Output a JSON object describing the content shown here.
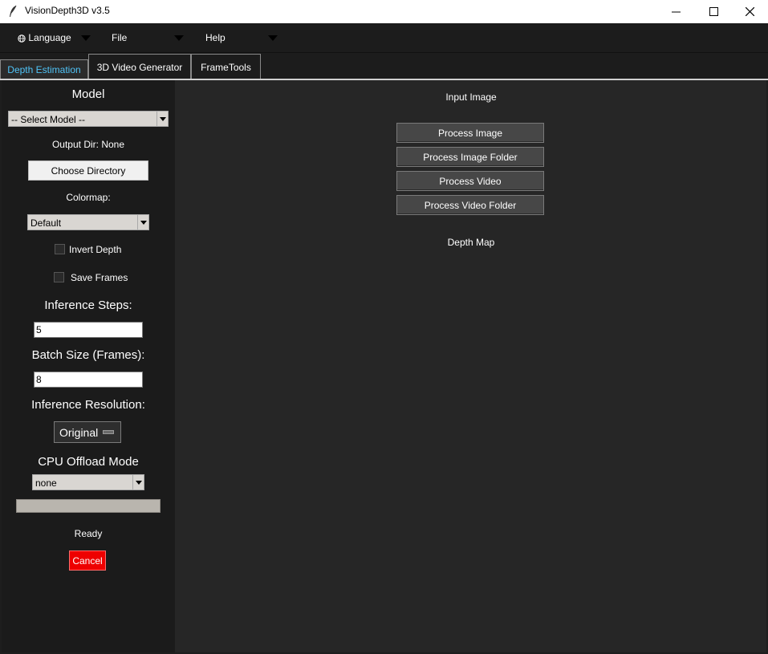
{
  "window": {
    "title": "VisionDepth3D v3.5"
  },
  "menubar": {
    "items": [
      {
        "label": "Language",
        "icon": "globe-icon"
      },
      {
        "label": "File"
      },
      {
        "label": "Help"
      }
    ]
  },
  "tabs": [
    {
      "label": "Depth Estimation",
      "active": true
    },
    {
      "label": "3D Video Generator",
      "active": false
    },
    {
      "label": "FrameTools",
      "active": false
    }
  ],
  "sidebar": {
    "model_label": "Model",
    "model_select": "-- Select Model --",
    "output_dir_label": "Output Dir: None",
    "choose_dir_button": "Choose Directory",
    "colormap_label": "Colormap:",
    "colormap_select": "Default",
    "invert_depth_label": "Invert Depth",
    "save_frames_label": "Save Frames",
    "inference_steps_label": "Inference Steps:",
    "inference_steps_value": "5",
    "batch_size_label": "Batch Size (Frames):",
    "batch_size_value": "8",
    "inference_resolution_label": "Inference Resolution:",
    "inference_resolution_value": "Original",
    "cpu_offload_label": "CPU Offload Mode",
    "cpu_offload_select": "none",
    "progress": 0,
    "status": "Ready",
    "cancel_button": "Cancel"
  },
  "main": {
    "input_image_label": "Input Image",
    "buttons": {
      "process_image": "Process Image",
      "process_image_folder": "Process Image Folder",
      "process_video": "Process Video",
      "process_video_folder": "Process Video Folder"
    },
    "depth_map_label": "Depth Map"
  },
  "colors": {
    "active_tab_text": "#4fc3f7",
    "cancel": "#ee0000",
    "sidebar_bg": "#1b1b1b",
    "main_bg": "#262626"
  }
}
